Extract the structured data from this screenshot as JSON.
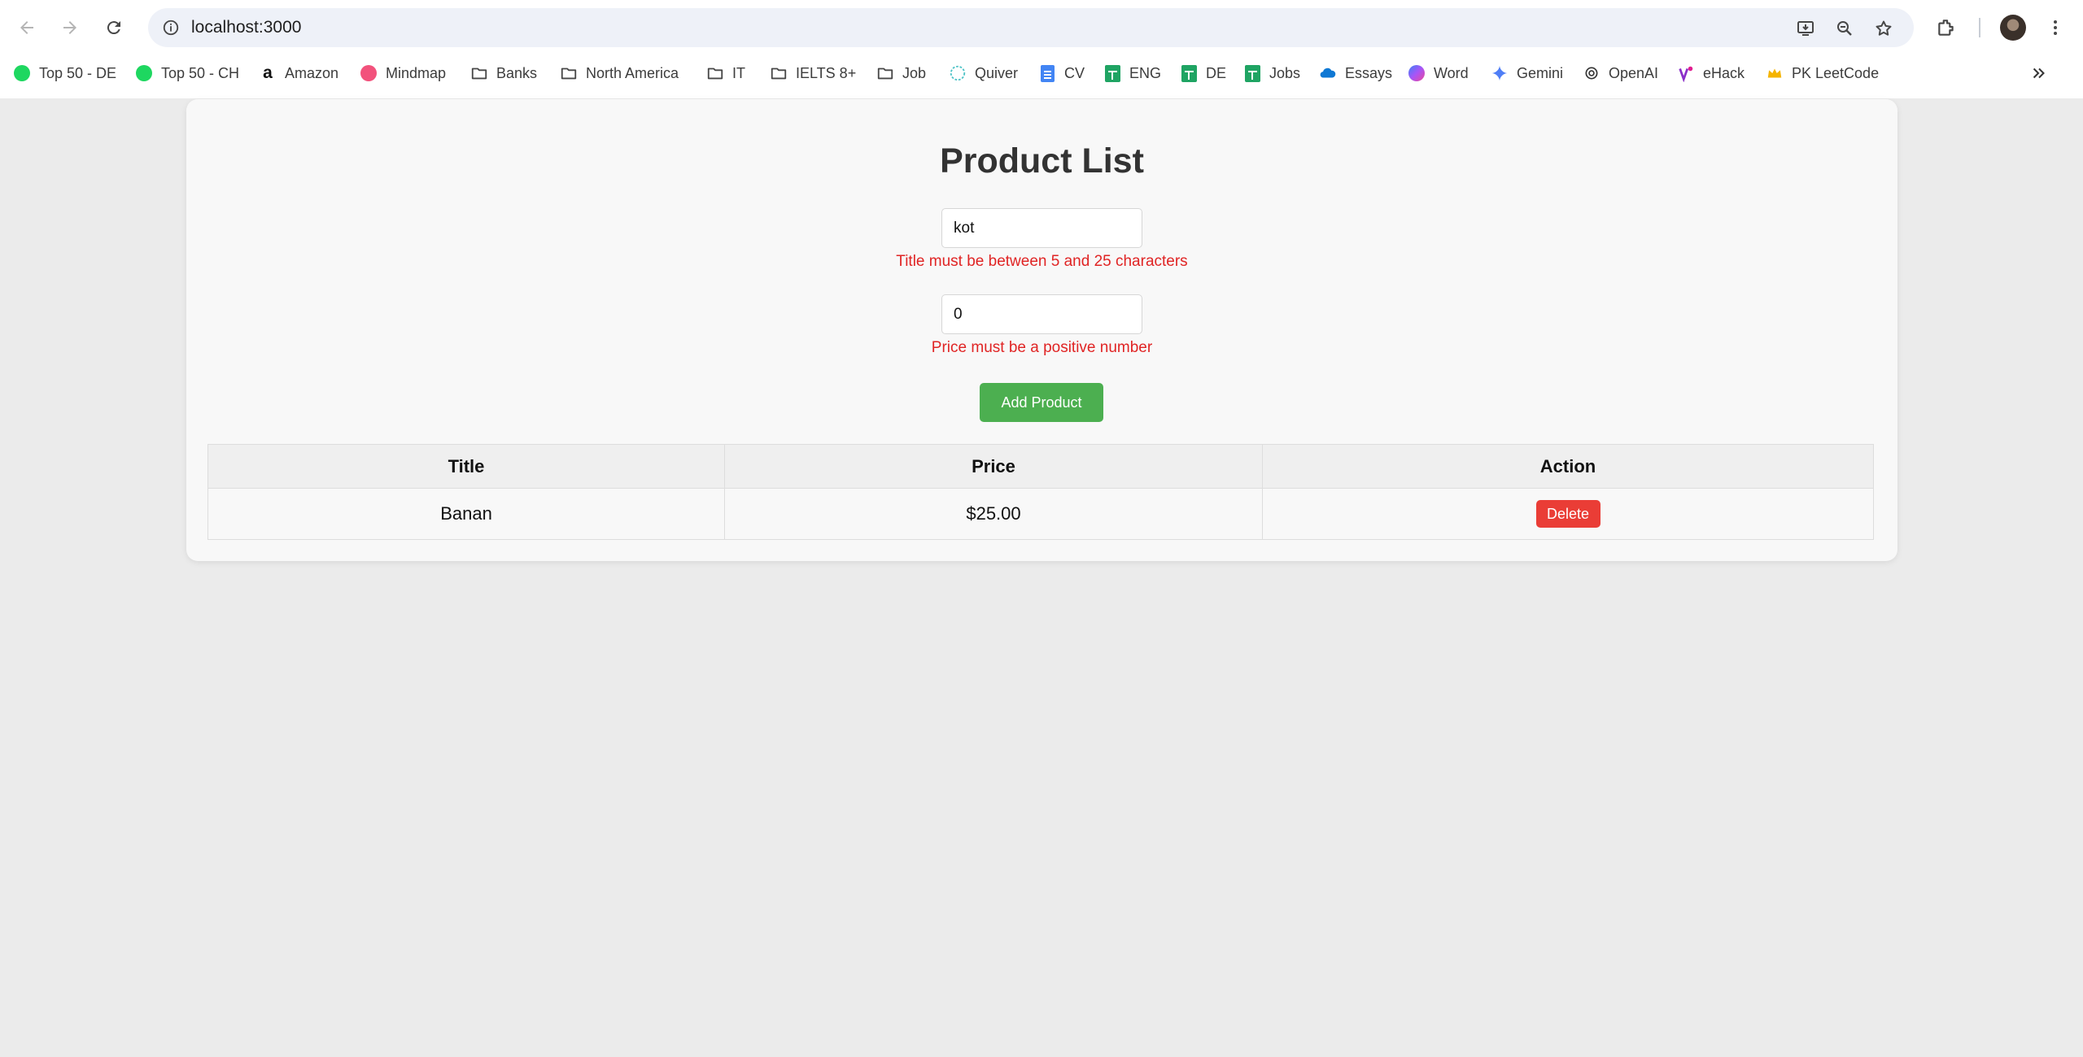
{
  "browser": {
    "url": "localhost:3000",
    "bookmarks": [
      {
        "label": "Top 50 - DE",
        "icon": "spotify-icon"
      },
      {
        "label": "Top 50 - CH",
        "icon": "spotify-icon"
      },
      {
        "label": "Amazon",
        "icon": "amazon-icon"
      },
      {
        "label": "Mindmap",
        "icon": "mindmap-icon"
      },
      {
        "label": "Banks",
        "icon": "folder-icon"
      },
      {
        "label": "North America",
        "icon": "folder-icon"
      },
      {
        "label": "IT",
        "icon": "folder-icon"
      },
      {
        "label": "IELTS 8+",
        "icon": "folder-icon"
      },
      {
        "label": "Job",
        "icon": "folder-icon"
      },
      {
        "label": "Quiver",
        "icon": "quiver-icon"
      },
      {
        "label": "CV",
        "icon": "google-docs-icon"
      },
      {
        "label": "ENG",
        "icon": "google-sheets-icon"
      },
      {
        "label": "DE",
        "icon": "google-sheets-icon"
      },
      {
        "label": "Jobs",
        "icon": "google-sheets-icon"
      },
      {
        "label": "Essays",
        "icon": "onedrive-icon"
      },
      {
        "label": "Word",
        "icon": "copilot-icon"
      },
      {
        "label": "Gemini",
        "icon": "gemini-icon"
      },
      {
        "label": "OpenAI",
        "icon": "openai-icon"
      },
      {
        "label": "eHack",
        "icon": "ehack-icon"
      },
      {
        "label": "PK LeetCode",
        "icon": "crown-icon"
      }
    ]
  },
  "page": {
    "title": "Product List",
    "title_input": {
      "value": "kot",
      "error": "Title must be between 5 and 25 characters"
    },
    "price_input": {
      "value": "0",
      "error": "Price must be a positive number"
    },
    "add_button": "Add Product",
    "table": {
      "headers": [
        "Title",
        "Price",
        "Action"
      ],
      "rows": [
        {
          "title": "Banan",
          "price": "$25.00",
          "action": "Delete"
        }
      ]
    }
  },
  "colors": {
    "add_button": "#4caf50",
    "delete_button": "#ea3d36",
    "error_text": "#e02424",
    "page_background": "#ebebeb"
  }
}
